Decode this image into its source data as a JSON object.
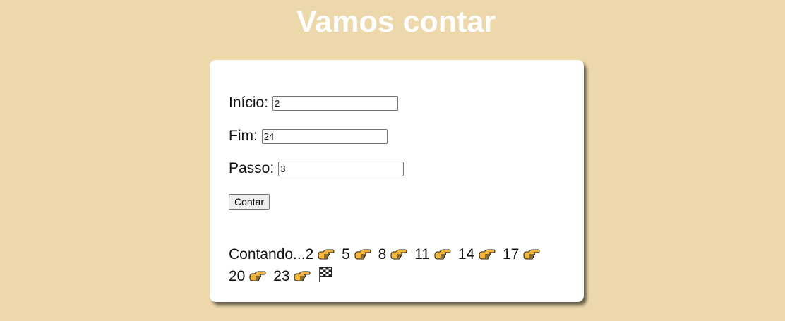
{
  "page": {
    "title": "Vamos contar"
  },
  "form": {
    "inicio_label": "Início:",
    "inicio_value": "2",
    "fim_label": "Fim:",
    "fim_value": "24",
    "passo_label": "Passo:",
    "passo_value": "3",
    "button_label": "Contar"
  },
  "result": {
    "prefix": "Contando...",
    "numbers": [
      "2",
      "5",
      "8",
      "11",
      "14",
      "17",
      "20",
      "23"
    ],
    "separator_icon": "pointing-hand-icon",
    "end_icon": "checkered-flag-icon"
  },
  "colors": {
    "background": "#ecd8ab",
    "title": "#ffffff",
    "card": "#ffffff",
    "hand": "#f4b63a"
  }
}
